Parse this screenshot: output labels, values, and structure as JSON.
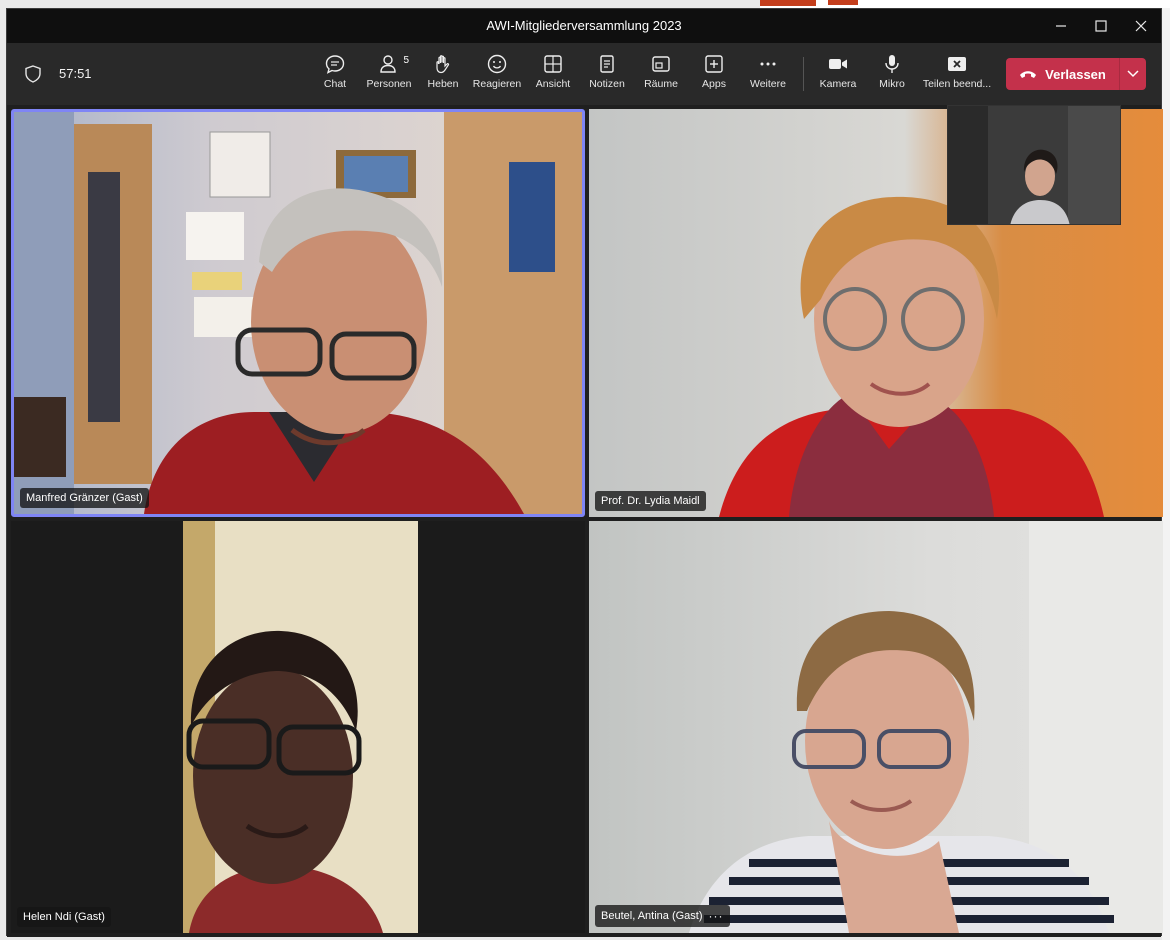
{
  "window": {
    "title": "AWI-Mitgliederversammlung 2023"
  },
  "toolbar": {
    "timer": "57:51",
    "buttons": [
      {
        "label": "Chat",
        "icon": "chat-icon"
      },
      {
        "label": "Personen",
        "icon": "people-icon",
        "count": "5"
      },
      {
        "label": "Heben",
        "icon": "raise-hand-icon"
      },
      {
        "label": "Reagieren",
        "icon": "emoji-icon"
      },
      {
        "label": "Ansicht",
        "icon": "layout-icon"
      },
      {
        "label": "Notizen",
        "icon": "notes-icon"
      },
      {
        "label": "Räume",
        "icon": "rooms-icon"
      },
      {
        "label": "Apps",
        "icon": "apps-icon"
      },
      {
        "label": "Weitere",
        "icon": "more-icon"
      },
      {
        "label": "Kamera",
        "icon": "camera-icon"
      },
      {
        "label": "Mikro",
        "icon": "mic-icon"
      },
      {
        "label": "Teilen beend...",
        "icon": "stop-share-icon"
      }
    ],
    "leave_label": "Verlassen"
  },
  "participants": [
    {
      "name": "Manfred Gränzer (Gast)",
      "speaking": true
    },
    {
      "name": "Prof. Dr. Lydia Maidl",
      "speaking": false
    },
    {
      "name": "Helen Ndi (Gast)",
      "speaking": false
    },
    {
      "name": "Beutel, Antina (Gast)",
      "speaking": false,
      "more": "···"
    }
  ],
  "colors": {
    "accent_speaking": "#7f85f5",
    "leave_button": "#c4314b",
    "toolbar_bg": "#292929",
    "titlebar_bg": "#0f0f0f"
  }
}
